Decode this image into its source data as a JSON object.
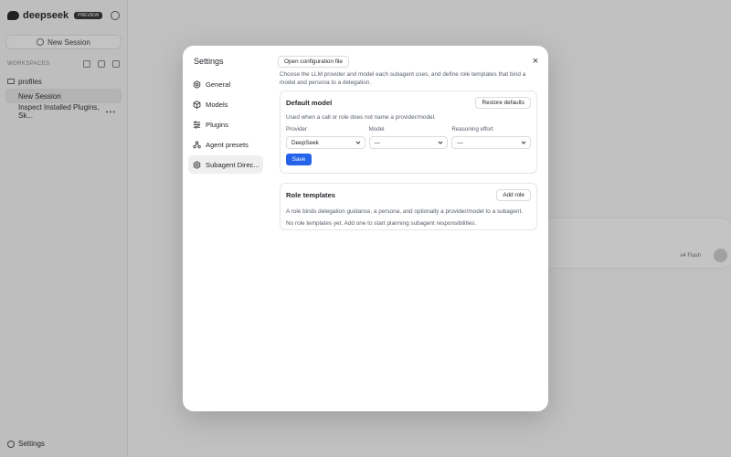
{
  "sidebar": {
    "brand": "deepseek",
    "badge": "PREVIEW",
    "new_session": "New Session",
    "workspaces_label": "WORKSPACES",
    "folder": "profiles",
    "sessions": [
      {
        "label": "New Session",
        "active": true
      },
      {
        "label": "Inspect Installed Plugins, Sk...",
        "active": false,
        "more": "•••"
      }
    ],
    "settings": "Settings"
  },
  "composer": {
    "model": "v4 Flash"
  },
  "modal": {
    "title": "Settings",
    "open_config": "Open configuration file",
    "close": "×",
    "nav": [
      {
        "label": "General",
        "icon": "gear-icon"
      },
      {
        "label": "Models",
        "icon": "cube-icon"
      },
      {
        "label": "Plugins",
        "icon": "sliders-icon"
      },
      {
        "label": "Agent presets",
        "icon": "agents-icon"
      },
      {
        "label": "Subagent Direc...",
        "icon": "hexagon-icon",
        "active": true
      }
    ],
    "intro": "Choose the LLM provider and model each subagent uses, and define role templates that bind a model and persona to a delegation.",
    "default_model": {
      "title": "Default model",
      "restore": "Restore defaults",
      "description": "Used when a call or role does not name a provider/model.",
      "provider_label": "Provider",
      "provider_value": "DeepSeek",
      "model_label": "Model",
      "model_value": "—",
      "effort_label": "Reasoning effort",
      "effort_value": "—",
      "save": "Save"
    },
    "role_templates": {
      "title": "Role templates",
      "add": "Add role",
      "description": "A role binds delegation guidance, a persona, and optionally a provider/model to a subagent.",
      "empty": "No role templates yet. Add one to start planning subagent responsibilities."
    }
  },
  "colors": {
    "accent": "#2563eb",
    "overlay": "rgba(0,0,0,0.22)"
  }
}
